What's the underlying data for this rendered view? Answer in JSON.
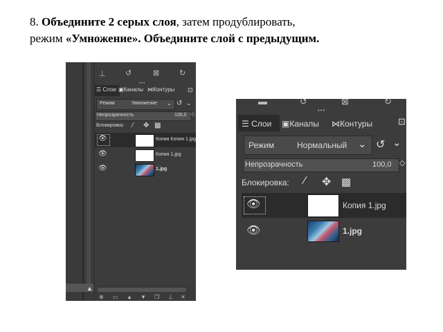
{
  "instruction": {
    "number": "8.",
    "bold1": "Объедините 2 серых слоя",
    "text1": ", затем продублировать,",
    "text2": "режим ",
    "bold2": "«Умножение». Объедините слой с предыдущим."
  },
  "screenshot_left": {
    "tabs": {
      "layers": "Слои",
      "channels": "Каналы",
      "paths": "Контуры"
    },
    "mode_label": "Режим",
    "mode_value": "Умножение",
    "opacity_label": "Непрозрачность",
    "opacity_value": "100,0",
    "lock_label": "Блокировка:",
    "layers": [
      {
        "name": "Копия Копия 1.jpg",
        "thumb": "white",
        "selected": true
      },
      {
        "name": "Копия 1.jpg",
        "thumb": "white",
        "selected": false
      },
      {
        "name": "1.jpg",
        "thumb": "photo",
        "selected": false
      }
    ]
  },
  "screenshot_right": {
    "tabs": {
      "layers": "Слои",
      "channels": "Каналы",
      "paths": "Контуры"
    },
    "mode_label": "Режим",
    "mode_value": "Нормальный",
    "opacity_label": "Непрозрачность",
    "opacity_value": "100,0",
    "lock_label": "Блокировка:",
    "layers": [
      {
        "name": "Копия 1.jpg",
        "thumb": "white",
        "selected": true
      },
      {
        "name": "1.jpg",
        "thumb": "photo",
        "selected": false
      }
    ]
  },
  "icons": {
    "eye": "eye-icon",
    "brush": "paint-lock-icon",
    "move": "position-lock-icon",
    "alpha": "alpha-lock-icon",
    "undo": "undo-icon",
    "redo": "redo-icon"
  }
}
